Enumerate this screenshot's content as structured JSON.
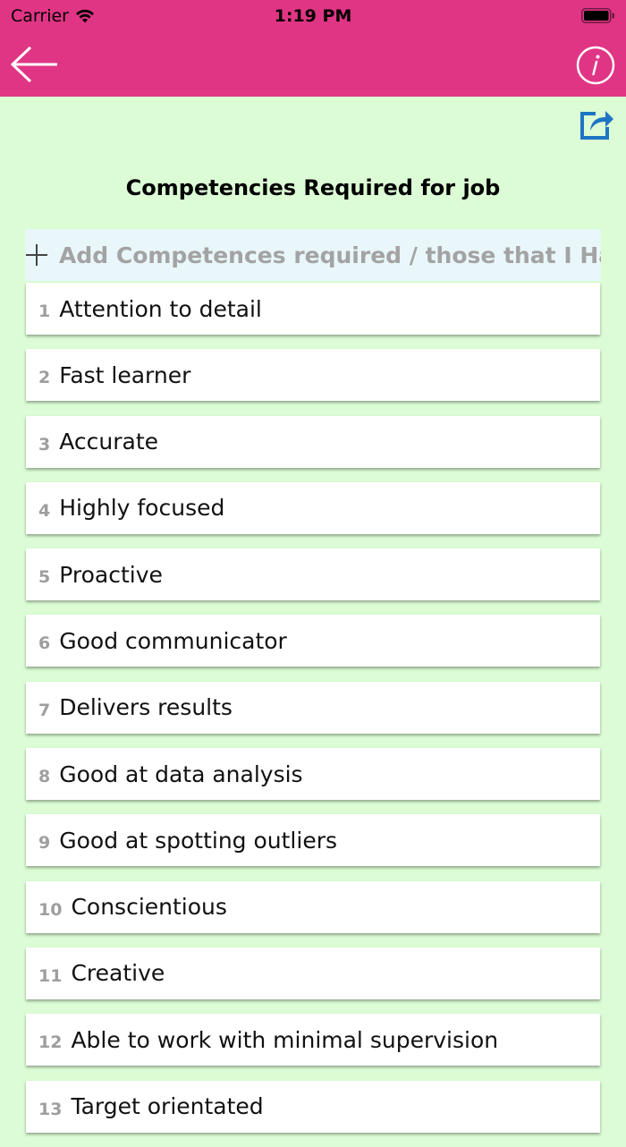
{
  "status_bar": {
    "carrier": "Carrier",
    "time": "1:19 PM"
  },
  "header": {
    "back_icon": "arrow-left-icon",
    "info_icon": "info-circle-icon",
    "share_icon": "share-export-icon",
    "color": "#e03585"
  },
  "page": {
    "title": "Competencies Required for job",
    "add_label": "Add Competences required / those that I Have",
    "background": "#dbfcd4"
  },
  "competencies": [
    {
      "num": "1",
      "label": "Attention to detail"
    },
    {
      "num": "2",
      "label": "Fast learner"
    },
    {
      "num": "3",
      "label": "Accurate"
    },
    {
      "num": "4",
      "label": "Highly focused"
    },
    {
      "num": "5",
      "label": "Proactive"
    },
    {
      "num": "6",
      "label": "Good communicator"
    },
    {
      "num": "7",
      "label": "Delivers results"
    },
    {
      "num": "8",
      "label": "Good at data analysis"
    },
    {
      "num": "9",
      "label": "Good at spotting outliers"
    },
    {
      "num": "10",
      "label": "Conscientious"
    },
    {
      "num": "11",
      "label": "Creative"
    },
    {
      "num": "12",
      "label": "Able to work with minimal supervision"
    },
    {
      "num": "13",
      "label": "Target orientated"
    }
  ]
}
